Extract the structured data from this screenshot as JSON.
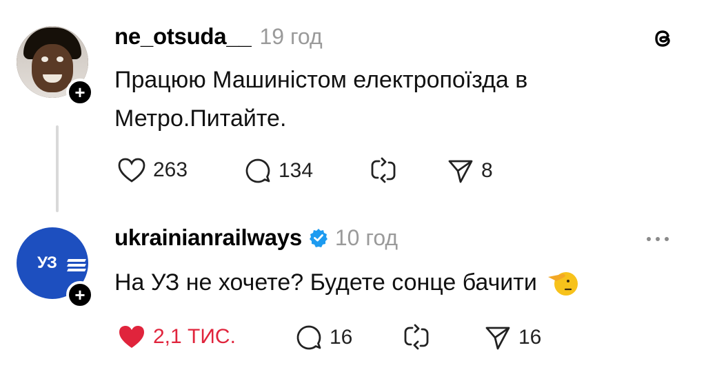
{
  "posts": [
    {
      "username": "ne_otsuda__",
      "time": "19 год",
      "text_line1": "Працюю Машиністом електропоїзда в",
      "text_line2": "Метро.Питайте.",
      "likes": "263",
      "replies": "134",
      "shares": "8",
      "liked": false
    },
    {
      "username": "ukrainianrailways",
      "verified": true,
      "time": "10 год",
      "text": "На УЗ не хочете? Будете сонце бачити",
      "avatar_logo": "УЗ",
      "likes": "2,1 ТИС.",
      "replies": "16",
      "shares": "16",
      "liked": true
    }
  ],
  "icons": {
    "threads": "threads-logo-icon",
    "more": "more-options-icon",
    "like": "heart-icon",
    "reply": "comment-icon",
    "repost": "repost-icon",
    "share": "send-icon"
  },
  "colors": {
    "like_active": "#e0243c",
    "verified": "#1d9bf0",
    "uz_blue": "#1d4fbf",
    "muted": "#9a9a9a"
  }
}
